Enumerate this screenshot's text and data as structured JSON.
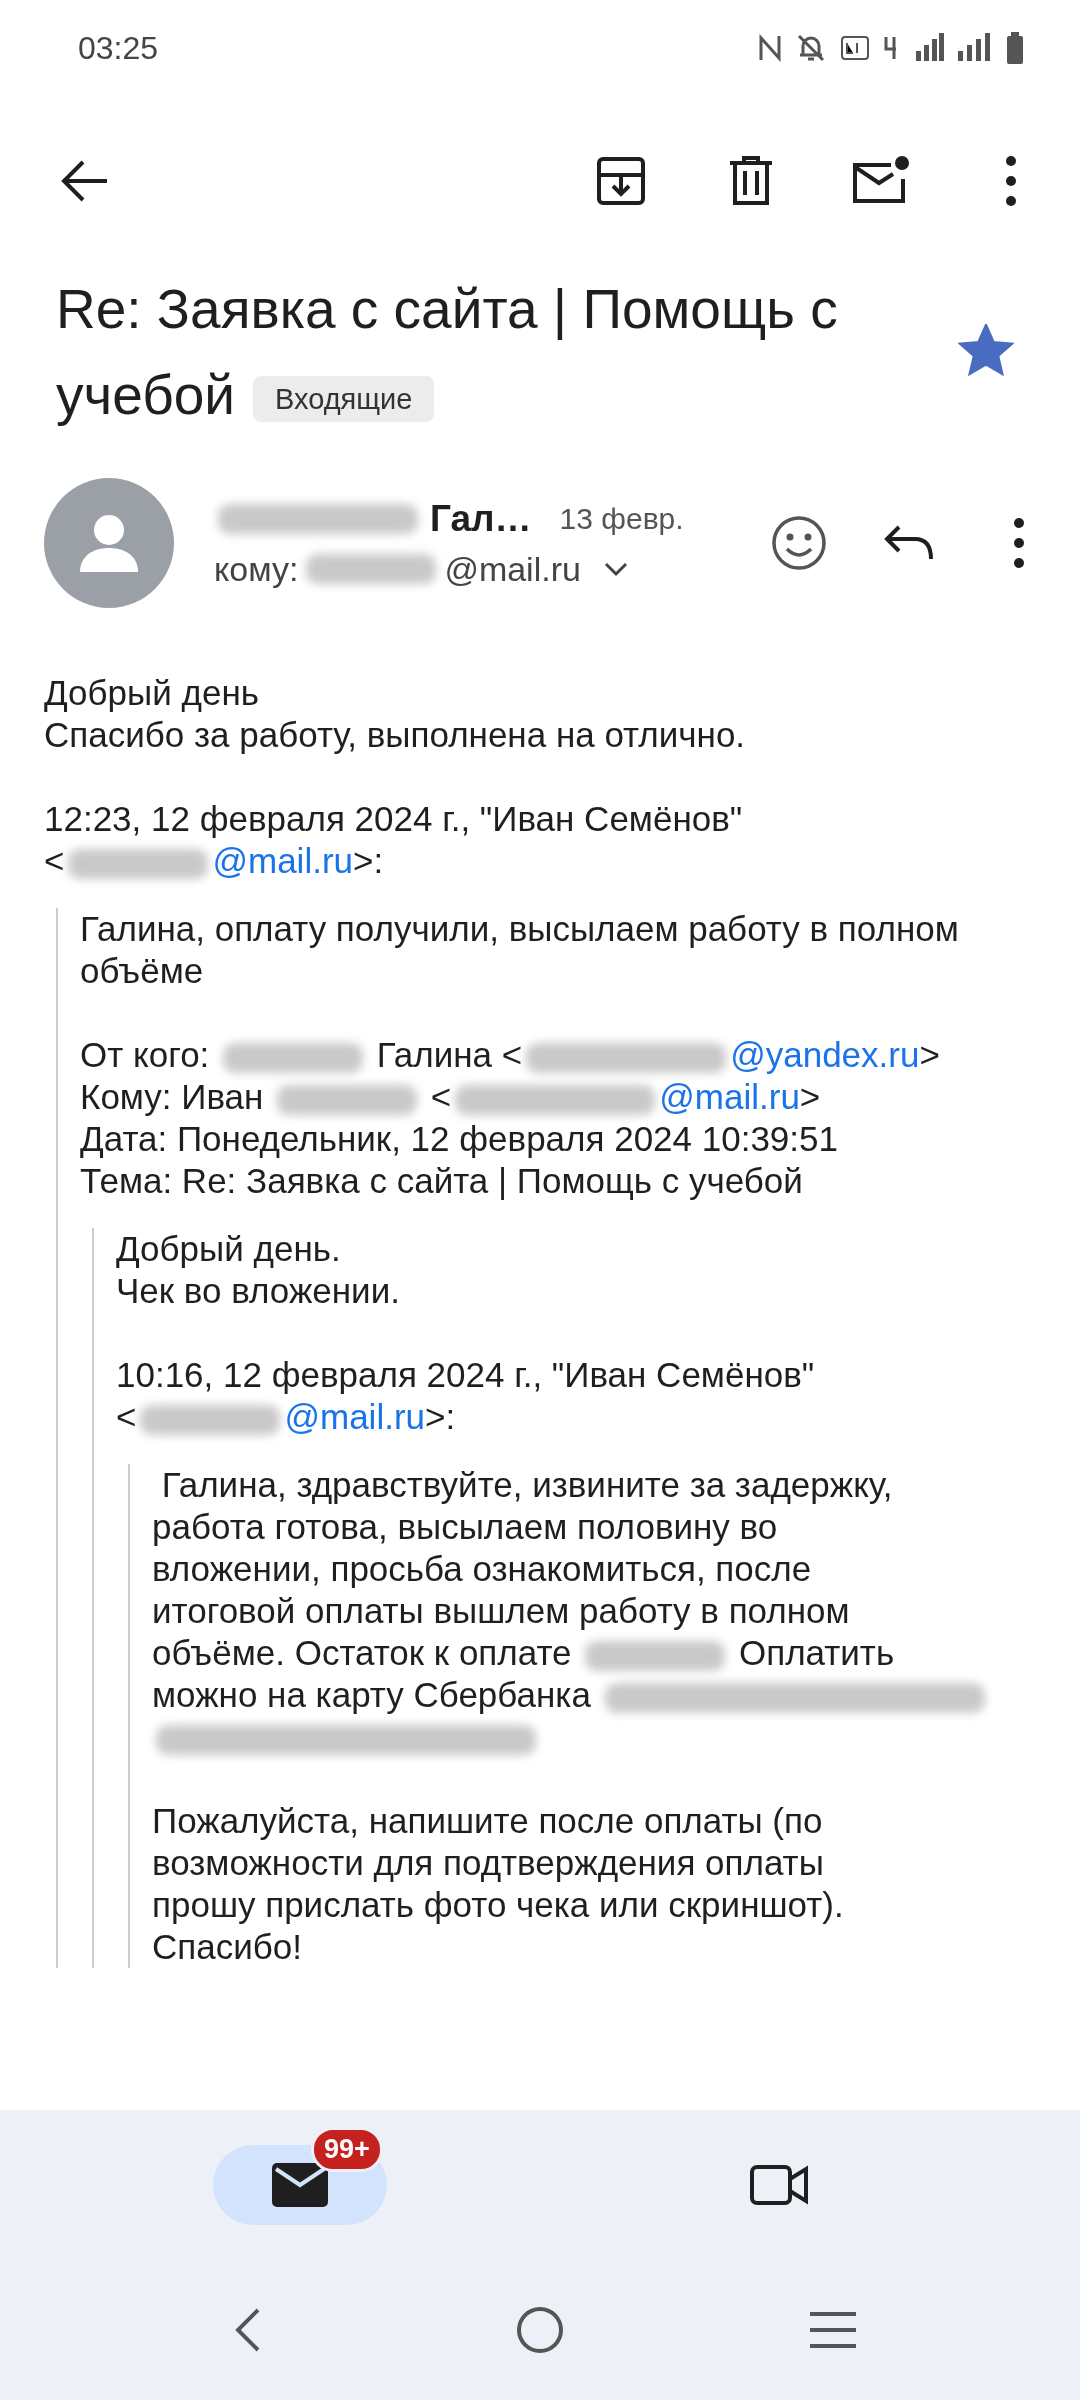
{
  "status_bar": {
    "time": "03:25"
  },
  "toolbar": {
    "actions": [
      {
        "kind": "archive"
      },
      {
        "kind": "delete"
      },
      {
        "kind": "unread"
      },
      {
        "kind": "more"
      }
    ]
  },
  "subject": {
    "title": "Re: Заявка с сайта | Помощь с учебой",
    "label": "Входящие",
    "starred": true
  },
  "message": {
    "sender": "Гал…",
    "date": "13 февр.",
    "to_prefix": "кому:",
    "to_suffix": "@mail.ru"
  },
  "body": {
    "paragraphs": [
      [
        [
          {
            "kind": "text",
            "text": "Добрый день"
          }
        ],
        [
          {
            "kind": "text",
            "text": "Спасибо за работу, выполнена на отлично."
          }
        ]
      ],
      [
        [
          {
            "kind": "text",
            "text": "12:23, 12 февраля 2024 г., \"Иван Семёнов\""
          }
        ],
        [
          {
            "kind": "text",
            "text": "<"
          },
          {
            "kind": "blur"
          },
          {
            "kind": "link",
            "text": "@mail.ru"
          },
          {
            "kind": "text",
            "text": ">:"
          }
        ]
      ]
    ],
    "children": [
      {
        "paragraphs": [
          [
            [
              {
                "kind": "text",
                "text": "Галина, оплату получили, высылаем работу в полном"
              }
            ],
            [
              {
                "kind": "text",
                "text": "объёме"
              }
            ]
          ],
          [
            [
              {
                "kind": "text",
                "text": "От кого: "
              },
              {
                "kind": "blur"
              },
              {
                "kind": "text",
                "text": " Галина <"
              },
              {
                "kind": "blurwide"
              },
              {
                "kind": "link",
                "text": "@yandex.ru"
              },
              {
                "kind": "text",
                "text": ">"
              }
            ],
            [
              {
                "kind": "text",
                "text": "Кому: Иван "
              },
              {
                "kind": "blur"
              },
              {
                "kind": "text",
                "text": " <"
              },
              {
                "kind": "blurwide"
              },
              {
                "kind": "link",
                "text": "@mail.ru"
              },
              {
                "kind": "text",
                "text": ">"
              }
            ],
            [
              {
                "kind": "text",
                "text": "Дата: Понедельник, 12 февраля 2024 10:39:51"
              }
            ],
            [
              {
                "kind": "text",
                "text": "Тема: Re: Заявка с сайта | Помощь с учебой"
              }
            ]
          ]
        ],
        "children": [
          {
            "paragraphs": [
              [
                [
                  {
                    "kind": "text",
                    "text": "Добрый день."
                  }
                ],
                [
                  {
                    "kind": "text",
                    "text": "Чек во вложении."
                  }
                ]
              ],
              [
                [
                  {
                    "kind": "text",
                    "text": "10:16, 12 февраля 2024 г., \"Иван Семёнов\""
                  }
                ],
                [
                  {
                    "kind": "text",
                    "text": "<"
                  },
                  {
                    "kind": "blur"
                  },
                  {
                    "kind": "link",
                    "text": "@mail.ru"
                  },
                  {
                    "kind": "text",
                    "text": ">:"
                  }
                ]
              ]
            ],
            "children": [
              {
                "paragraphs": [
                  [
                    [
                      {
                        "kind": "text",
                        "text": " Галина, здравствуйте, извините за задержку,"
                      }
                    ],
                    [
                      {
                        "kind": "text",
                        "text": "работа готова, высылаем половину во"
                      }
                    ],
                    [
                      {
                        "kind": "text",
                        "text": "вложении, просьба ознакомиться, после"
                      }
                    ],
                    [
                      {
                        "kind": "text",
                        "text": "итоговой оплаты вышлем работу в полном"
                      }
                    ],
                    [
                      {
                        "kind": "text",
                        "text": "объёме. Остаток к оплате "
                      },
                      {
                        "kind": "blur"
                      },
                      {
                        "kind": "text",
                        "text": " Оплатить"
                      }
                    ],
                    [
                      {
                        "kind": "text",
                        "text": "можно на карту Сбербанка "
                      },
                      {
                        "kind": "blurlong"
                      }
                    ],
                    [
                      {
                        "kind": "blurlong"
                      }
                    ]
                  ],
                  [
                    [
                      {
                        "kind": "text",
                        "text": "Пожалуйста, напишите после оплаты (по"
                      }
                    ],
                    [
                      {
                        "kind": "text",
                        "text": "возможности для подтверждения оплаты"
                      }
                    ],
                    [
                      {
                        "kind": "text",
                        "text": "прошу прислать фото чека или скриншот)."
                      }
                    ],
                    [
                      {
                        "kind": "text",
                        "text": "Спасибо!"
                      }
                    ]
                  ]
                ]
              }
            ]
          }
        ]
      }
    ]
  },
  "bottom_nav": [
    {
      "kind": "mail",
      "selected": true,
      "badge": "99+"
    },
    {
      "kind": "video",
      "selected": false
    }
  ]
}
